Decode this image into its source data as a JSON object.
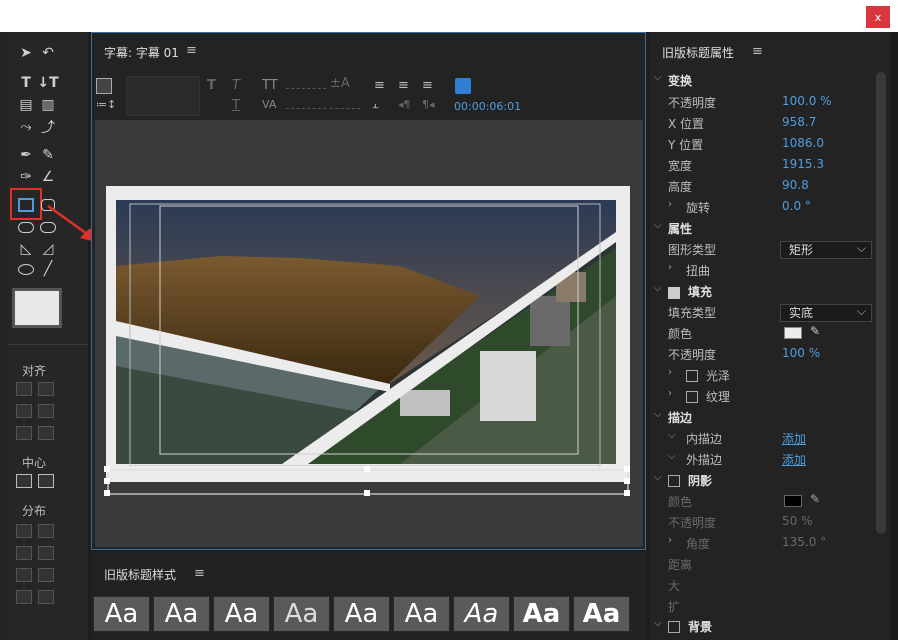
{
  "window": {
    "close_glyph": "x"
  },
  "tools": {
    "section_align": "对齐",
    "section_center": "中心",
    "section_distribute": "分布"
  },
  "editor": {
    "title": "字幕: 字幕 01",
    "menu_glyph": "≡",
    "timecode": "00:00:06:01"
  },
  "styles": {
    "title": "旧版标题样式",
    "menu_glyph": "≡",
    "swatch_text": "Aa",
    "swatches": [
      "Aa",
      "Aa",
      "Aa",
      "Aa",
      "Aa",
      "Aa",
      "Aa",
      "Aa",
      "Aa"
    ]
  },
  "props": {
    "title": "旧版标题属性",
    "menu_glyph": "≡",
    "transform": {
      "header": "变换",
      "opacity_label": "不透明度",
      "opacity": "100.0 %",
      "x_label": "X 位置",
      "x": "958.7",
      "y_label": "Y 位置",
      "y": "1086.0",
      "width_label": "宽度",
      "width": "1915.3",
      "height_label": "高度",
      "height": "90.8",
      "rotation_label": "旋转",
      "rotation": "0.0 °"
    },
    "attributes": {
      "header": "属性",
      "shape_label": "图形类型",
      "shape": "矩形",
      "distort_label": "扭曲"
    },
    "fill": {
      "header": "填充",
      "type_label": "填充类型",
      "type": "实底",
      "color_label": "颜色",
      "color": "#ececec",
      "opacity_label": "不透明度",
      "opacity": "100 %",
      "sheen_label": "光泽",
      "texture_label": "纹理"
    },
    "stroke": {
      "header": "描边",
      "inner_label": "内描边",
      "inner_action": "添加",
      "outer_label": "外描边",
      "outer_action": "添加"
    },
    "shadow": {
      "header": "阴影",
      "color_label": "颜色",
      "color": "#000000",
      "opacity_label": "不透明度",
      "opacity": "50 %",
      "angle_label": "角度",
      "angle": "135.0 °",
      "distance_label": "距离",
      "size_label": "大",
      "spread_label": "扩"
    },
    "background": {
      "header": "背景"
    }
  }
}
